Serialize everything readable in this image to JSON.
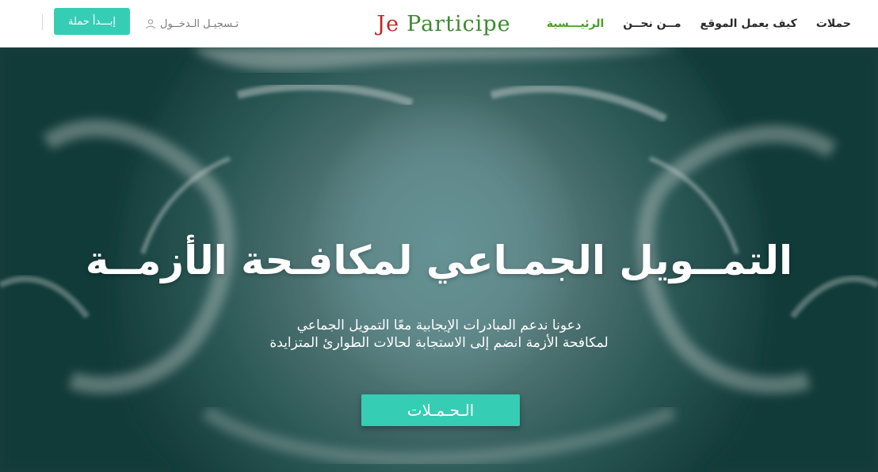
{
  "nav": {
    "items": [
      {
        "label": "الرئيـــسية",
        "active": true
      },
      {
        "label": "مــن نحــن",
        "active": false
      },
      {
        "label": "كيف يعمل الموقع",
        "active": false
      },
      {
        "label": "حملات",
        "active": false
      }
    ]
  },
  "logo": {
    "part1": "Je",
    "part2": "Participe"
  },
  "header": {
    "login_label": "تـسجيـل الـدخــول",
    "start_button_label": "إبـــدأ حملة"
  },
  "hero": {
    "title": "التمــويل الجمـاعي لمكافـحة الأزمــة",
    "subtitle_line1": "دعونا ندعم المبادرات الإيجابية معًا التمويل الجماعي",
    "subtitle_line2": "لمكافحة الأزمة انضم إلى الاستجابة لحالات الطوارئ المتزايدة",
    "button_label": "الـحـمـلات"
  },
  "colors": {
    "accent": "#36cdb5",
    "nav_active": "#4a9e2a",
    "logo_red": "#c0262c",
    "logo_green": "#3c8a2e"
  },
  "icons": {
    "login": "user-icon"
  }
}
